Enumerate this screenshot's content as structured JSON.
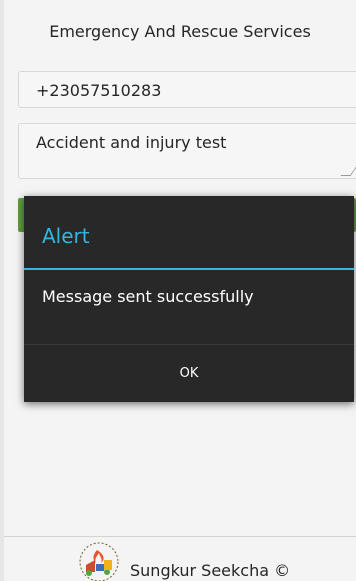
{
  "app": {
    "title": "Emergency And Rescue Services"
  },
  "form": {
    "phone_value": "+23057510283",
    "message_value": "Accident and injury test"
  },
  "dialog": {
    "title": "Alert",
    "message": "Message sent successfully",
    "ok_label": "OK",
    "accent_color": "#33b5e5"
  },
  "footer": {
    "text": "Sungkur Seekcha ©"
  },
  "icons": {
    "logo": "fire-rescue-logo-icon"
  }
}
